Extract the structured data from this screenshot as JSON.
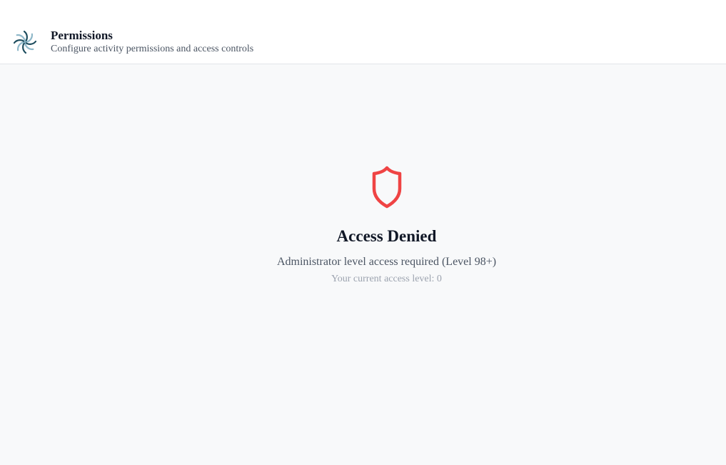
{
  "header": {
    "logo_icon": "pinwheel-logo-icon",
    "title": "Permissions",
    "subtitle": "Configure activity permissions and access controls"
  },
  "access_denied": {
    "icon": "shield-icon",
    "icon_color": "#ef4444",
    "title": "Access Denied",
    "message": "Administrator level access required (Level 98+)",
    "current_level": "Your current access level: 0"
  },
  "colors": {
    "background": "#f8f9fa",
    "header_background": "#ffffff",
    "text_primary": "#111827",
    "text_secondary": "#4b5563",
    "text_muted": "#9ca3af"
  }
}
